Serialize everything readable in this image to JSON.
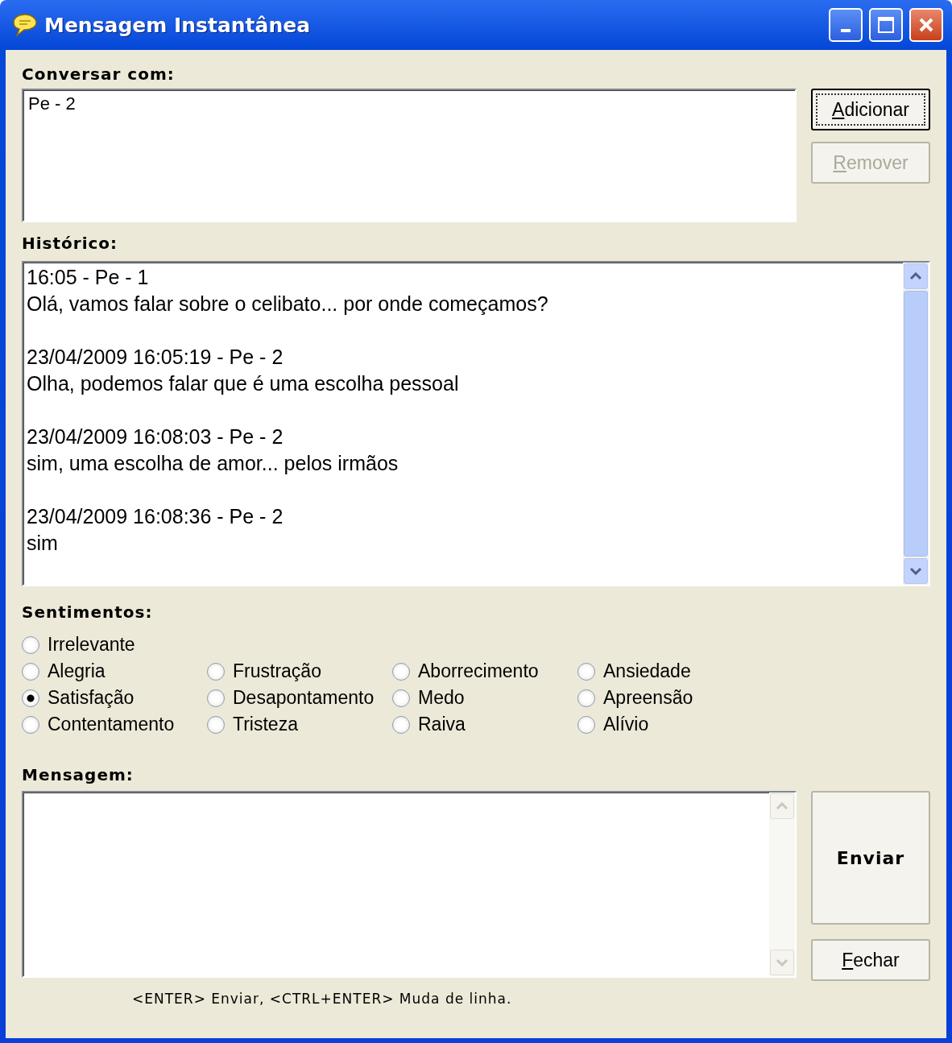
{
  "window": {
    "title": "Mensagem Instantânea"
  },
  "chat_with": {
    "label": "Conversar com:",
    "participants": [
      "Pe - 2"
    ]
  },
  "side_buttons": [
    {
      "label": "Adicionar",
      "focused": true,
      "disabled": false,
      "underlined_key": true
    },
    {
      "label": "Remover",
      "focused": false,
      "disabled": true,
      "underlined_key": true
    }
  ],
  "history": {
    "label": "Histórico:",
    "entries": [
      {
        "header": "16:05 - Pe - 1",
        "text": "Olá, vamos falar sobre o celibato... por onde começamos?"
      },
      {
        "header": "23/04/2009 16:05:19 - Pe - 2",
        "text": "Olha, podemos falar que é uma escolha pessoal"
      },
      {
        "header": "23/04/2009 16:08:03 - Pe - 2",
        "text": "sim, uma escolha de amor... pelos irmãos"
      },
      {
        "header": "23/04/2009 16:08:36 - Pe - 2",
        "text": "sim"
      }
    ]
  },
  "feelings": {
    "label": "Sentimentos:",
    "rows": [
      [
        {
          "label": "Irrelevante",
          "selected": false
        }
      ],
      [
        {
          "label": "Alegria",
          "selected": false
        },
        {
          "label": "Frustração",
          "selected": false
        },
        {
          "label": "Aborrecimento",
          "selected": false
        },
        {
          "label": "Ansiedade",
          "selected": false
        }
      ],
      [
        {
          "label": "Satisfação",
          "selected": true
        },
        {
          "label": "Desapontamento",
          "selected": false
        },
        {
          "label": "Medo",
          "selected": false
        },
        {
          "label": "Apreensão",
          "selected": false
        }
      ],
      [
        {
          "label": "Contentamento",
          "selected": false
        },
        {
          "label": "Tristeza",
          "selected": false
        },
        {
          "label": "Raiva",
          "selected": false
        },
        {
          "label": "Alívio",
          "selected": false
        }
      ]
    ]
  },
  "message": {
    "label": "Mensagem:",
    "hint": "<ENTER> Enviar, <CTRL+ENTER> Muda de linha."
  },
  "send_button": {
    "label": "Enviar",
    "underlined_key": false
  },
  "close_button": {
    "label": "Fechar",
    "underlined_key": true
  }
}
